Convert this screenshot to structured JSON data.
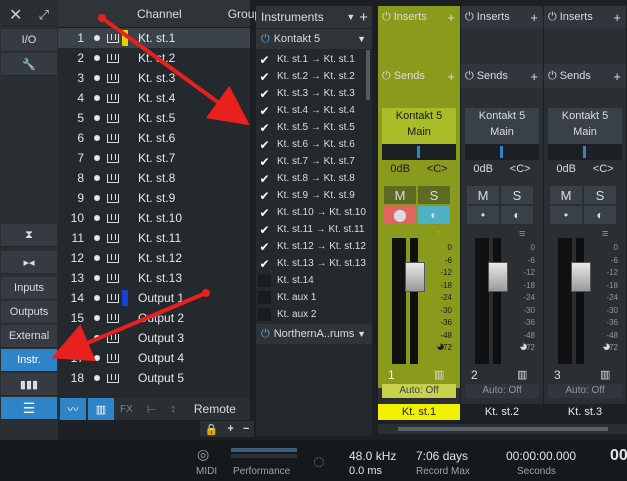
{
  "left": {
    "io": "I/O",
    "inputs": "Inputs",
    "outputs": "Outputs",
    "external": "External",
    "instr": "Instr."
  },
  "channels": {
    "header_channel": "Channel",
    "header_group": "Group",
    "rows": [
      {
        "num": "1",
        "name": "Kt. st.1",
        "color": "#e6d000"
      },
      {
        "num": "2",
        "name": "Kt. st.2",
        "color": ""
      },
      {
        "num": "3",
        "name": "Kt. st.3",
        "color": ""
      },
      {
        "num": "4",
        "name": "Kt. st.4",
        "color": ""
      },
      {
        "num": "5",
        "name": "Kt. st.5",
        "color": ""
      },
      {
        "num": "6",
        "name": "Kt. st.6",
        "color": ""
      },
      {
        "num": "7",
        "name": "Kt. st.7",
        "color": ""
      },
      {
        "num": "8",
        "name": "Kt. st.8",
        "color": ""
      },
      {
        "num": "9",
        "name": "Kt. st.9",
        "color": ""
      },
      {
        "num": "10",
        "name": "Kt. st.10",
        "color": ""
      },
      {
        "num": "11",
        "name": "Kt. st.11",
        "color": ""
      },
      {
        "num": "12",
        "name": "Kt. st.12",
        "color": ""
      },
      {
        "num": "13",
        "name": "Kt. st.13",
        "color": ""
      },
      {
        "num": "14",
        "name": "Output 1",
        "color": "#1a3fd6"
      },
      {
        "num": "15",
        "name": "Output 2",
        "color": ""
      },
      {
        "num": "16",
        "name": "Output 3",
        "color": ""
      },
      {
        "num": "17",
        "name": "Output 4",
        "color": ""
      },
      {
        "num": "18",
        "name": "Output 5",
        "color": ""
      }
    ],
    "fx": "FX",
    "remote": "Remote"
  },
  "instruments": {
    "title": "Instruments",
    "plugin1": "Kontakt 5",
    "rows": [
      {
        "label": "Kt. st.1 → Kt. st.1",
        "checked": true
      },
      {
        "label": "Kt. st.2 → Kt. st.2",
        "checked": true
      },
      {
        "label": "Kt. st.3 → Kt. st.3",
        "checked": true
      },
      {
        "label": "Kt. st.4 → Kt. st.4",
        "checked": true
      },
      {
        "label": "Kt. st.5 → Kt. st.5",
        "checked": true
      },
      {
        "label": "Kt. st.6 → Kt. st.6",
        "checked": true
      },
      {
        "label": "Kt. st.7 → Kt. st.7",
        "checked": true
      },
      {
        "label": "Kt. st.8 → Kt. st.8",
        "checked": true
      },
      {
        "label": "Kt. st.9 → Kt. st.9",
        "checked": true
      },
      {
        "label": "Kt. st.10 → Kt. st.10",
        "checked": true
      },
      {
        "label": "Kt. st.11 → Kt. st.11",
        "checked": true
      },
      {
        "label": "Kt. st.12 → Kt. st.12",
        "checked": true
      },
      {
        "label": "Kt. st.13 → Kt. st.13",
        "checked": true
      },
      {
        "label": "Kt. st.14",
        "checked": false
      },
      {
        "label": "Kt. aux 1",
        "checked": false
      },
      {
        "label": "Kt. aux 2",
        "checked": false
      }
    ],
    "plugin2": "NorthernA..rums"
  },
  "mixer": {
    "inserts": "Inserts",
    "sends": "Sends",
    "strips": [
      {
        "plugin": "Kontakt 5",
        "preset": "Main",
        "vol": "0dB",
        "pan": "<C>",
        "num": "1",
        "auto": "Auto: Off",
        "name": "Kt. st.1"
      },
      {
        "plugin": "Kontakt 5",
        "preset": "Main",
        "vol": "0dB",
        "pan": "<C>",
        "num": "2",
        "auto": "Auto: Off",
        "name": "Kt. st.2"
      },
      {
        "plugin": "Kontakt 5",
        "preset": "Main",
        "vol": "0dB",
        "pan": "<C>",
        "num": "3",
        "auto": "Auto: Off",
        "name": "Kt. st.3"
      }
    ],
    "mute": "M",
    "solo": "S",
    "scale": [
      "0",
      "-6",
      "-12",
      "-18",
      "-24",
      "-30",
      "-36",
      "-48",
      "-72"
    ]
  },
  "status": {
    "midi": "MIDI",
    "performance": "Performance",
    "rate": "48.0 kHz",
    "latency": "0.0 ms",
    "days": "7:06 days",
    "record_max": "Record Max",
    "time": "00:00:00.000",
    "seconds": "Seconds",
    "time2": "00"
  }
}
